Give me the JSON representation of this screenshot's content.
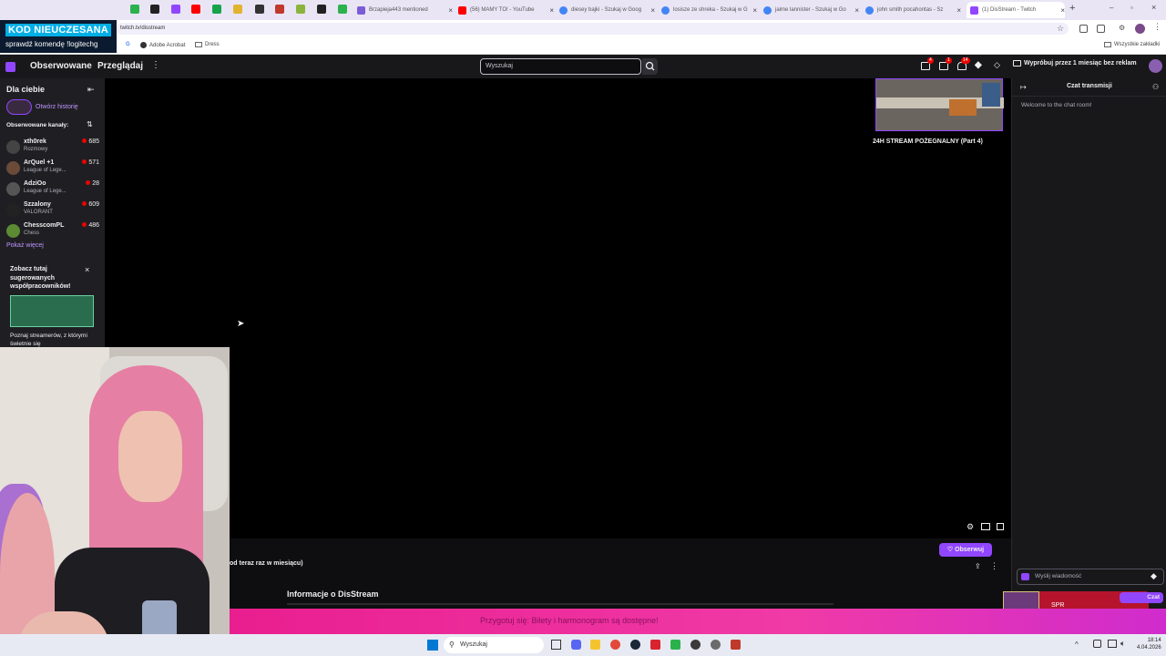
{
  "browser": {
    "tabs": [
      {
        "title": "Brzapieja443 mentioned",
        "color": "#7b5cd6"
      },
      {
        "title": "(56) MAMY TO! - YouTube",
        "color": "#ff0000"
      },
      {
        "title": "diesey bajki - Szukaj w Goog",
        "color": "#4285f4"
      },
      {
        "title": "losisze ze shreka - Szukaj w G",
        "color": "#4285f4"
      },
      {
        "title": "jaime lannister - Szukaj w Go",
        "color": "#4285f4"
      },
      {
        "title": "john smith pocahontas - Sz",
        "color": "#4285f4"
      },
      {
        "title": "(1) DisStream - Twitch",
        "color": "#9146ff"
      }
    ],
    "url": "twitch.tv/disstream",
    "bookmarks": [
      "Adobe Acrobat",
      "Dress"
    ],
    "all_bookmarks": "Wszystkie zakładki"
  },
  "overlay": {
    "line1": "KOD NIEUCZESANA",
    "line2": "sprawdź komendę !logitechg"
  },
  "twitch": {
    "nav_followed": "Obserwowane",
    "nav_browse": "Przeglądaj",
    "search_placeholder": "Wyszukaj",
    "notif_badges": [
      "4",
      "1",
      "14"
    ],
    "try_label": "Wypróbuj przez 1 miesiąc bez reklam"
  },
  "sidebar": {
    "title": "Dla ciebie",
    "history_label": "Otwórz historię",
    "followed_label": "Obserwowane kanały:",
    "channels": [
      {
        "name": "xth0rek",
        "category": "Rozmowy",
        "viewers": "685"
      },
      {
        "name": "ArQuel +1",
        "category": "League of Lege...",
        "viewers": "571"
      },
      {
        "name": "AdziOo",
        "category": "League of Lege...",
        "viewers": "28"
      },
      {
        "name": "Szzalony",
        "category": "VALORANT",
        "viewers": "609"
      },
      {
        "name": "ChesscomPL",
        "category": "Chess",
        "viewers": "486"
      }
    ],
    "show_more": "Pokaż więcej",
    "promo_title": "Zobacz tutaj sugerowanych współpracowników!",
    "promo_text": "Poznaj streamerów, z którymi świetnie się"
  },
  "player": {
    "mini_title": "24H STREAM POŻEGNALNY (Part 4)"
  },
  "below": {
    "subline": "od teraz raz w miesiącu)",
    "follow_label": "Obserwuj",
    "about_label": "Informacje o DisStream"
  },
  "chat": {
    "header": "Czat transmisji",
    "welcome": "Welcome to the chat room!",
    "input_placeholder": "Wyślij wiadomość",
    "send_label": "Czat",
    "ad_text": "SPR"
  },
  "banner": {
    "text": "Przygotuj się: Bilety i harmonogram są dostępne!"
  },
  "taskbar": {
    "search": "Wyszukaj",
    "time": "18:14",
    "date": "4.04.2026"
  }
}
